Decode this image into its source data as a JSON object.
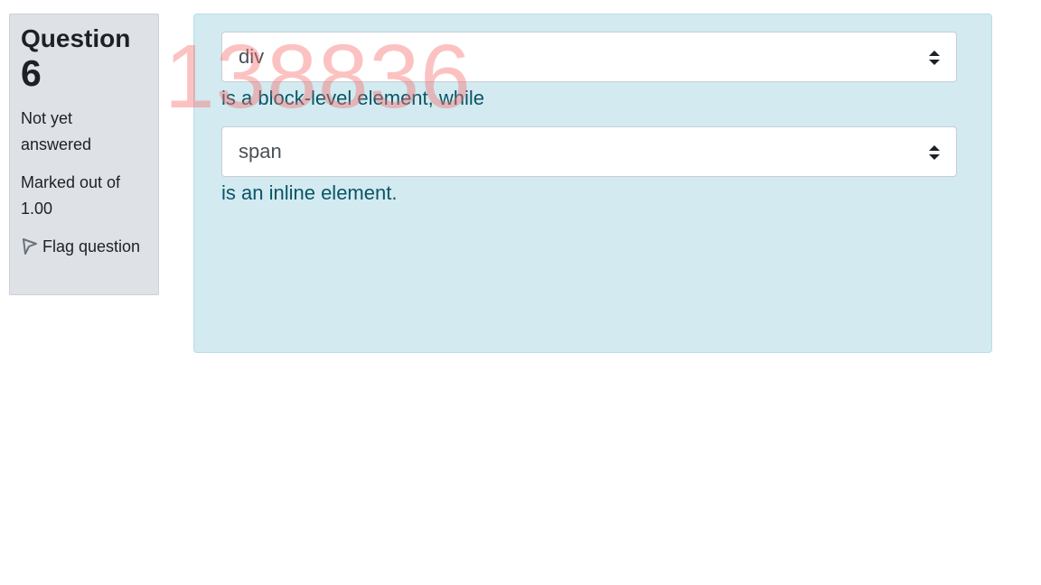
{
  "question": {
    "title_label": "Question",
    "number": "6",
    "state": "Not yet answered",
    "grade": "Marked out of 1.00",
    "flag_label": "Flag question"
  },
  "content": {
    "select1": {
      "selected": "div"
    },
    "text1": "is a block-level element, while",
    "select2": {
      "selected": "span"
    },
    "text2": "is an inline element."
  },
  "watermark": "138836",
  "icons": {
    "flag": "flag-icon",
    "select_arrows": "select-arrows-icon"
  },
  "colors": {
    "info_bg": "#dee2e6",
    "content_bg": "#d2eaf0",
    "question_text": "#0b5566",
    "watermark": "#f86e6e"
  }
}
